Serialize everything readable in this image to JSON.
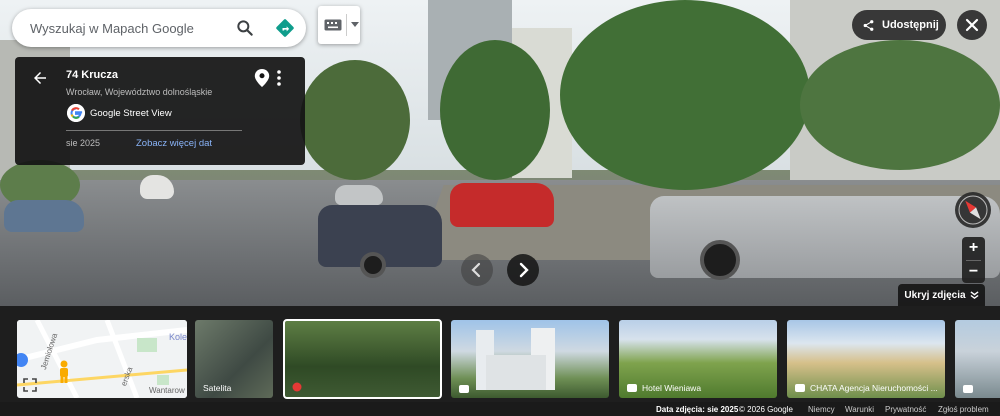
{
  "search": {
    "placeholder": "Wyszukaj w Mapach Google"
  },
  "place": {
    "title": "74 Krucza",
    "subtitle": "Wrocław, Województwo dolnośląskie",
    "source": "Google Street View",
    "date": "sie 2025",
    "more_dates_link": "Zobacz więcej dat"
  },
  "share": {
    "label": "Udostępnij"
  },
  "hide_photos": {
    "label": "Ukryj zdjęcia"
  },
  "thumbnails": [
    {
      "caption": ""
    },
    {
      "caption": "Satelita"
    },
    {
      "caption": ""
    },
    {
      "caption": ""
    },
    {
      "caption": "Hotel Wieniawa"
    },
    {
      "caption": "CHATA Agencja Nieruchomości ..."
    },
    {
      "caption": ""
    }
  ],
  "minimap": {
    "street_1": "Jemiołowa",
    "street_2": "Kole",
    "street_3": "Wantarow",
    "street_4": "erska"
  },
  "footer": {
    "photo_date": "Data zdjęcia: sie 2025",
    "copyright": "© 2026 Google",
    "country": "Niemcy",
    "terms": "Warunki",
    "privacy": "Prywatność",
    "report": "Zgłoś problem"
  },
  "colors": {
    "accent_blue": "#8ab4f8",
    "panel_dark": "#141414",
    "directions_teal": "#0f9d8c"
  }
}
